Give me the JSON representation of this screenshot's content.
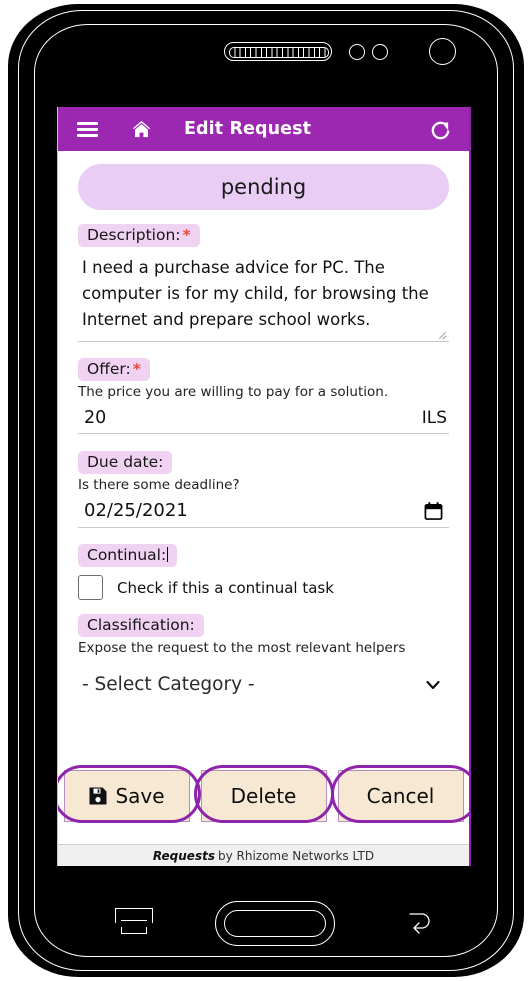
{
  "device": {
    "nav": {
      "recent_apps": "recent-apps",
      "home": "home",
      "back": "back"
    }
  },
  "appbar": {
    "menu_icon": "hamburger-menu-icon",
    "home_icon": "home-icon",
    "title": "Edit Request",
    "refresh_icon": "refresh-icon",
    "background": "#9c27b0"
  },
  "status": {
    "value": "pending",
    "background": "#e9cdf4"
  },
  "form": {
    "description": {
      "label": "Description:",
      "required": "*",
      "value": "I need a purchase advice for PC. The computer is for my child, for browsing the Internet and prepare school works."
    },
    "offer": {
      "label": "Offer:",
      "required": "*",
      "hint": "The price you are willing to pay for a solution.",
      "value": "20",
      "unit": "ILS"
    },
    "due_date": {
      "label": "Due date:",
      "hint": "Is there some deadline?",
      "value": "02/25/2021",
      "icon": "calendar-icon"
    },
    "continual": {
      "label": "Continual:",
      "checkbox_label": "Check if this a continual task",
      "checked": false
    },
    "classification": {
      "label": "Classification:",
      "hint": "Expose the request to the most relevant helpers",
      "selected": "- Select Category -",
      "chevron": "chevron-down-icon"
    }
  },
  "buttons": {
    "save": {
      "label": "Save",
      "icon": "save-floppy-icon"
    },
    "delete": {
      "label": "Delete"
    },
    "cancel": {
      "label": "Cancel"
    },
    "fill": "#f6e8d2",
    "ring": "#8e24aa"
  },
  "footer": {
    "brand": "Requests",
    "text": " by Rhizome Networks LTD"
  }
}
